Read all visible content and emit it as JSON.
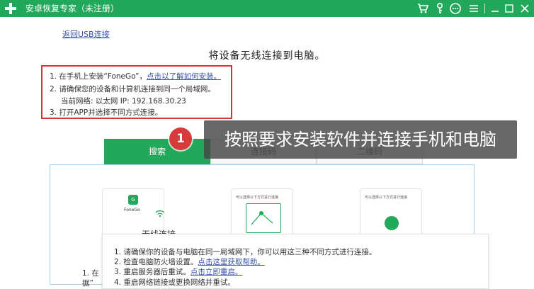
{
  "titlebar": {
    "title": "安卓恢复专家（未注册）",
    "icons": [
      "plus-logo-icon",
      "cart-icon",
      "key-icon",
      "chat-icon",
      "menu-icon",
      "minimize-icon",
      "maximize-icon",
      "close-icon"
    ],
    "color": "#21a85b"
  },
  "back_link": "返回USB连接",
  "heading": "将设备无线连接到电脑。",
  "steps": {
    "s1_prefix": "1. 在手机上安装“FoneGo”，",
    "s1_link": "点击以了解如何安装。",
    "s2": "2. 请确保您的设备和计算机连接到同一个局域网。",
    "s2b": "当前网络:  以太网    IP:  192.168.30.23",
    "s3": "3. 打开APP并选择不同方式连接。"
  },
  "caption": {
    "badge": "1",
    "text": "按照要求安装软件并连接手机和电脑"
  },
  "tabs": [
    "搜索",
    "连接码",
    "二维码"
  ],
  "cards": {
    "fonego": "FoneGo",
    "card2_title": "可以选择以下方式进行连接",
    "card3_title": "可以选择以下方式进行连接",
    "wireless_label": "无线连接"
  },
  "notes": {
    "n1": "1. 请确保你的设备与电脑在同一局域网下，你可以用这三种不同方式进行连接。",
    "n2_prefix": "2. 检查电脑防火墙设置。",
    "n2_link": "点击这里获取帮助。",
    "n3_prefix": "3. 重启服务器后重试。",
    "n3_link": "点击立即重启。",
    "n4": "4. 重启网络链接或更换网络并重试。"
  },
  "left_fragments": [
    "1. 在",
    "据”"
  ]
}
